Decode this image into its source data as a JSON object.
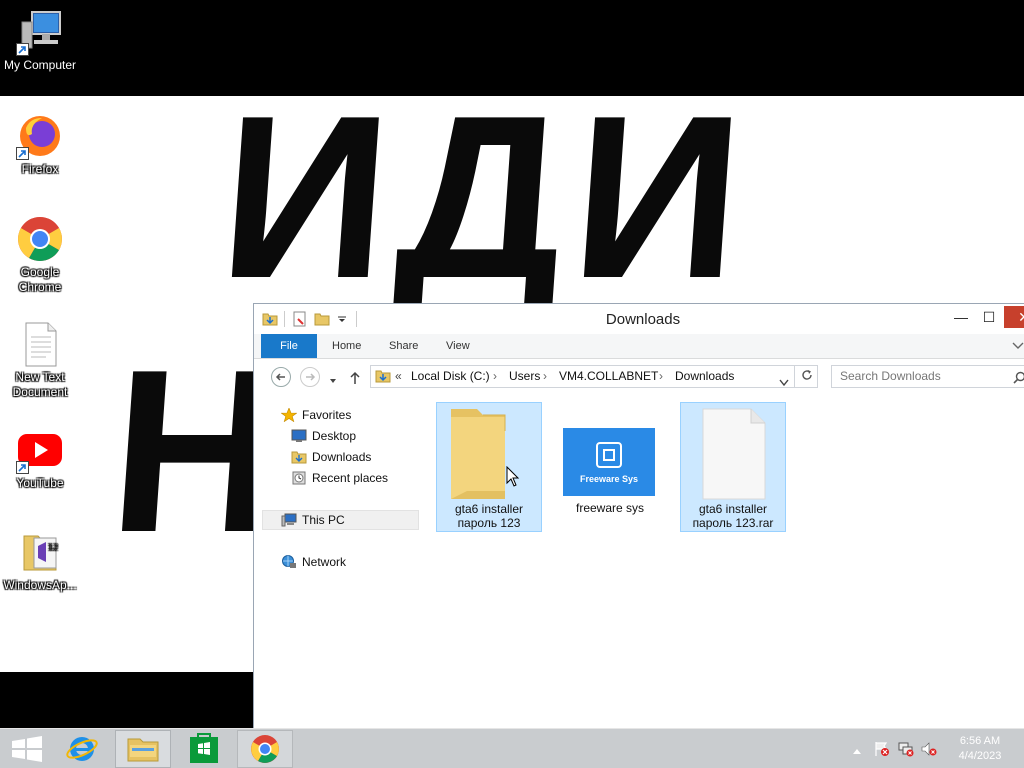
{
  "wallpaper": {
    "line1": "ИДИ",
    "line2": "Н"
  },
  "desktop_icons": [
    {
      "label": "My Computer",
      "icon": "computer-icon"
    },
    {
      "label": "Firefox",
      "icon": "firefox-icon"
    },
    {
      "label": "Google Chrome",
      "icon": "chrome-icon"
    },
    {
      "label": "New Text Document",
      "icon": "text-document-icon"
    },
    {
      "label": "YouTube",
      "icon": "youtube-icon"
    },
    {
      "label": "WindowsAp...",
      "icon": "archive-icon"
    }
  ],
  "window": {
    "title": "Downloads",
    "controls": {
      "minimize": "—",
      "maximize": "☐",
      "close": "✕"
    },
    "ribbon_tabs": [
      "File",
      "Home",
      "Share",
      "View"
    ],
    "address": {
      "overflow": "«",
      "segments": [
        "Local Disk (C:)",
        "Users",
        "VM4.COLLABNET",
        "Downloads"
      ],
      "separator": "›"
    },
    "search_placeholder": "Search Downloads",
    "nav_pane": {
      "favorites_label": "Favorites",
      "favorites": [
        "Desktop",
        "Downloads",
        "Recent places"
      ],
      "this_pc_label": "This PC",
      "network_label": "Network"
    },
    "files": [
      {
        "name_line1": "gta6 installer",
        "name_line2": "пароль 123",
        "type": "folder",
        "selected": true
      },
      {
        "name_line1": "freeware sys",
        "name_line2": "",
        "type": "image",
        "thumb_text": "Freeware Sys",
        "selected": false
      },
      {
        "name_line1": "gta6 installer",
        "name_line2": "пароль 123.rar",
        "type": "file",
        "selected": true
      }
    ]
  },
  "taskbar": {
    "items": [
      "start-button",
      "internet-explorer",
      "file-explorer",
      "store",
      "chrome"
    ],
    "clock": {
      "time": "6:56 AM",
      "date": "4/4/2023"
    }
  },
  "colors": {
    "file_tab": "#1979ca",
    "selection": "#cce8ff",
    "close_button": "#c7402c",
    "taskbar": "#c9cccf"
  }
}
